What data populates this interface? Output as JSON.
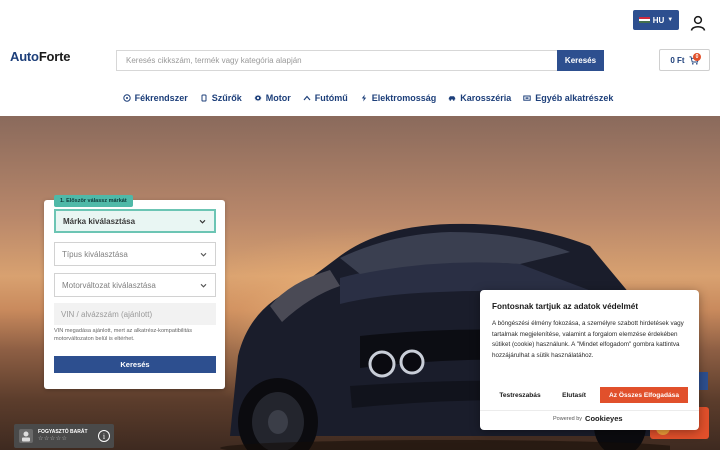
{
  "header": {
    "language": "HU",
    "logo_part1": "Auto",
    "logo_part2": "Forte",
    "search_placeholder": "Keresés cikkszám, termék vagy kategória alapján",
    "search_button": "Keresés",
    "cart_total": "0 Ft",
    "cart_count": "0"
  },
  "nav": {
    "items": [
      {
        "label": "Fékrendszer",
        "icon": "brake-icon"
      },
      {
        "label": "Szűrők",
        "icon": "filter-icon"
      },
      {
        "label": "Motor",
        "icon": "engine-icon"
      },
      {
        "label": "Futómű",
        "icon": "suspension-icon"
      },
      {
        "label": "Elektromosság",
        "icon": "lightning-icon"
      },
      {
        "label": "Karosszéria",
        "icon": "car-body-icon"
      },
      {
        "label": "Egyéb alkatrészek",
        "icon": "parts-icon"
      }
    ]
  },
  "selector": {
    "step_tag": "1. Először válassz márkát",
    "brand": "Márka kiválasztása",
    "type": "Típus kiválasztása",
    "variant": "Motorváltozat kiválasztása",
    "vin_placeholder": "VIN / alvázszám (ajánlott)",
    "vin_note": "VIN megadása ajánlott, mert az alkatrész-kompatibilitás motorváltozaton belül is eltérhet.",
    "search_button": "Keresés"
  },
  "consumer_badge": {
    "text": "FOGYASZTÓ BARÁT",
    "stars": "☆☆☆☆☆",
    "info": "i"
  },
  "cookie": {
    "title": "Fontosnak tartjuk az adatok védelmét",
    "text": "A böngészési élmény fokozása, a személyre szabott hirdetések vagy tartalmak megjelenítése, valamint a forgalom elemzése érdekében sütiket (cookie) használunk. A \"Mindet elfogadom\" gombra kattintva hozzájárulhat a sütik használatához.",
    "customize": "Testreszabás",
    "reject": "Elutasít",
    "accept": "Az Összes Elfogadása",
    "powered_by": "Powered by",
    "brand": "Cookieyes"
  },
  "colors": {
    "primary": "#2d4f8f",
    "accent": "#e1502b",
    "teal": "#4fb9a8"
  }
}
